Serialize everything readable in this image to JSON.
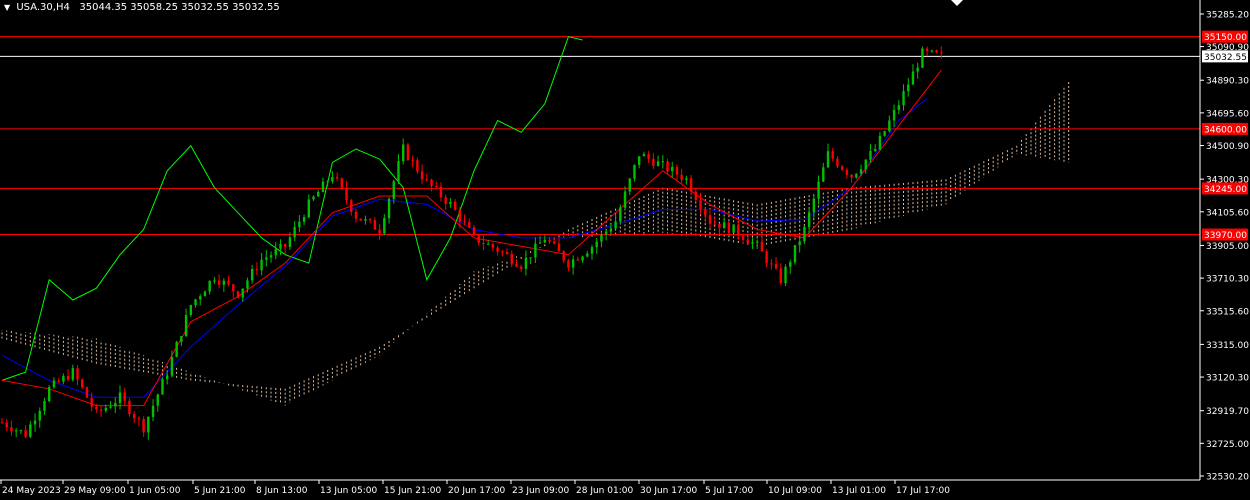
{
  "header": {
    "symbol_timeframe": "USA.30,H4",
    "ohlc": "35044.35 35058.25 35032.55 35032.55"
  },
  "colors": {
    "background": "#000000",
    "bull_candle": "#00c000",
    "bear_candle": "#ff0000",
    "tenkan": "#ff0000",
    "kijun": "#0000ff",
    "chikou": "#00ff00",
    "cloud": "#ffdab9",
    "hline": "#ff0000",
    "price_line": "#ffffff",
    "axis_text": "#ffffff"
  },
  "icons": {
    "menu_arrow": "triangle-down-icon",
    "shift_marker": "triangle-down-icon"
  },
  "chart_data": {
    "type": "candlestick",
    "ylim": [
      32530.2,
      35285.2
    ],
    "y_ticks": [
      "35285.20",
      "35090.90",
      "34890.30",
      "34695.60",
      "34500.90",
      "34300.30",
      "34105.60",
      "33905.00",
      "33710.30",
      "33515.60",
      "33315.00",
      "33120.30",
      "32919.70",
      "32725.00",
      "32530.20"
    ],
    "x_ticks": [
      "24 May 2023",
      "29 May 09:00",
      "1 Jun 05:00",
      "5 Jun 21:00",
      "8 Jun 13:00",
      "13 Jun 05:00",
      "15 Jun 21:00",
      "20 Jun 17:00",
      "23 Jun 09:00",
      "28 Jun 01:00",
      "30 Jun 17:00",
      "5 Jul 17:00",
      "10 Jul 09:00",
      "13 Jul 01:00",
      "17 Jul 17:00"
    ],
    "horizontal_levels": [
      {
        "label": "35150.00",
        "value": 35150.0
      },
      {
        "label": "34600.00",
        "value": 34600.0
      },
      {
        "label": "34245.00",
        "value": 34245.0
      },
      {
        "label": "33970.00",
        "value": 33970.0
      }
    ],
    "current_price": {
      "label": "35032.55",
      "value": 35032.55
    },
    "price_path": [
      [
        0,
        32850
      ],
      [
        5,
        32780
      ],
      [
        10,
        33050
      ],
      [
        15,
        33150
      ],
      [
        20,
        32900
      ],
      [
        25,
        33000
      ],
      [
        30,
        32820
      ],
      [
        35,
        33150
      ],
      [
        40,
        33550
      ],
      [
        45,
        33720
      ],
      [
        50,
        33620
      ],
      [
        55,
        33820
      ],
      [
        60,
        33900
      ],
      [
        65,
        34150
      ],
      [
        70,
        34330
      ],
      [
        75,
        34080
      ],
      [
        80,
        34000
      ],
      [
        85,
        34480
      ],
      [
        90,
        34280
      ],
      [
        95,
        34150
      ],
      [
        100,
        33950
      ],
      [
        105,
        33880
      ],
      [
        110,
        33790
      ],
      [
        115,
        33950
      ],
      [
        120,
        33800
      ],
      [
        125,
        33900
      ],
      [
        130,
        34050
      ],
      [
        135,
        34450
      ],
      [
        140,
        34380
      ],
      [
        145,
        34300
      ],
      [
        150,
        34050
      ],
      [
        155,
        34000
      ],
      [
        160,
        33900
      ],
      [
        165,
        33700
      ],
      [
        170,
        34000
      ],
      [
        175,
        34450
      ],
      [
        180,
        34320
      ],
      [
        185,
        34480
      ],
      [
        190,
        34750
      ],
      [
        195,
        35050
      ],
      [
        199,
        35035
      ]
    ],
    "tenkan_path": [
      [
        0,
        33100
      ],
      [
        10,
        33050
      ],
      [
        20,
        32950
      ],
      [
        30,
        32950
      ],
      [
        40,
        33450
      ],
      [
        50,
        33600
      ],
      [
        60,
        33800
      ],
      [
        70,
        34100
      ],
      [
        80,
        34200
      ],
      [
        90,
        34200
      ],
      [
        100,
        33950
      ],
      [
        110,
        33900
      ],
      [
        120,
        33850
      ],
      [
        130,
        34100
      ],
      [
        140,
        34350
      ],
      [
        150,
        34150
      ],
      [
        160,
        34000
      ],
      [
        170,
        33950
      ],
      [
        180,
        34250
      ],
      [
        190,
        34620
      ],
      [
        199,
        34950
      ]
    ],
    "kijun_path": [
      [
        0,
        33250
      ],
      [
        10,
        33100
      ],
      [
        20,
        33000
      ],
      [
        30,
        33000
      ],
      [
        40,
        33300
      ],
      [
        50,
        33550
      ],
      [
        60,
        33780
      ],
      [
        70,
        34080
      ],
      [
        80,
        34180
      ],
      [
        90,
        34150
      ],
      [
        100,
        34000
      ],
      [
        110,
        33950
      ],
      [
        120,
        33950
      ],
      [
        130,
        34030
      ],
      [
        140,
        34120
      ],
      [
        150,
        34120
      ],
      [
        160,
        34050
      ],
      [
        170,
        34060
      ],
      [
        180,
        34250
      ],
      [
        190,
        34650
      ],
      [
        196,
        34780
      ]
    ],
    "chikou_path": [
      [
        0,
        33100
      ],
      [
        5,
        33150
      ],
      [
        10,
        33700
      ],
      [
        15,
        33580
      ],
      [
        20,
        33650
      ],
      [
        25,
        33850
      ],
      [
        30,
        34000
      ],
      [
        35,
        34350
      ],
      [
        40,
        34500
      ],
      [
        45,
        34250
      ],
      [
        50,
        34100
      ],
      [
        55,
        33950
      ],
      [
        60,
        33850
      ],
      [
        65,
        33800
      ],
      [
        70,
        34400
      ],
      [
        75,
        34480
      ],
      [
        80,
        34420
      ],
      [
        85,
        34250
      ],
      [
        90,
        33700
      ],
      [
        95,
        33950
      ],
      [
        100,
        34350
      ],
      [
        105,
        34650
      ],
      [
        110,
        34580
      ],
      [
        115,
        34750
      ],
      [
        120,
        35150
      ],
      [
        123,
        35130
      ]
    ],
    "cloud": {
      "start_index": 0,
      "end_index": 226,
      "span_a": [
        [
          0,
          33350
        ],
        [
          20,
          33200
        ],
        [
          40,
          33100
        ],
        [
          60,
          33050
        ],
        [
          80,
          33300
        ],
        [
          100,
          33650
        ],
        [
          120,
          34000
        ],
        [
          140,
          34250
        ],
        [
          160,
          34150
        ],
        [
          180,
          34250
        ],
        [
          200,
          34300
        ],
        [
          215,
          34500
        ],
        [
          226,
          34880
        ]
      ],
      "span_b": [
        [
          0,
          33400
        ],
        [
          20,
          33350
        ],
        [
          40,
          33150
        ],
        [
          60,
          32950
        ],
        [
          80,
          33250
        ],
        [
          100,
          33750
        ],
        [
          120,
          33950
        ],
        [
          140,
          33980
        ],
        [
          160,
          33900
        ],
        [
          180,
          34000
        ],
        [
          200,
          34150
        ],
        [
          215,
          34450
        ],
        [
          226,
          34400
        ]
      ]
    }
  }
}
